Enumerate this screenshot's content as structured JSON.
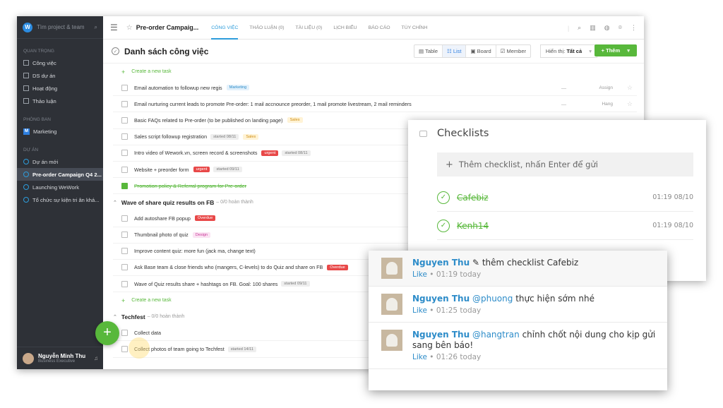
{
  "sidebar": {
    "search_placeholder": "Tìm project & team",
    "sections": [
      {
        "title": "QUAN TRỌNG",
        "items": [
          "Công việc",
          "DS dự án",
          "Hoạt động",
          "Thảo luận"
        ]
      },
      {
        "title": "PHÒNG BAN",
        "items": [
          "Marketing"
        ]
      },
      {
        "title": "DỰ ÁN",
        "items": [
          "Dự án mới",
          "Pre-order Campaign Q4 2...",
          "Launching WeWork",
          "Tổ chức sự kiện tri ân khá..."
        ]
      }
    ],
    "user": {
      "name": "Nguyễn Minh Thu",
      "role": "Business Executive"
    }
  },
  "topbar": {
    "title": "Pre-order Campaig...",
    "tabs": [
      "CÔNG VIỆC",
      "THẢO LUẬN (0)",
      "TÀI LIỆU (0)",
      "LỊCH BIỂU",
      "BÁO CÁO",
      "TÙY CHỈNH"
    ]
  },
  "header": {
    "title": "Danh sách công việc",
    "views": [
      "Table",
      "List",
      "Board",
      "Member"
    ],
    "filter_label": "Hiển thị:",
    "filter_value": "Tất cả",
    "add_label": "+ Thêm"
  },
  "create_task": "Create a new task",
  "group1": [
    {
      "title": "Email automation to followup new regis",
      "tag": "Marketing",
      "tag_type": "mk",
      "dash": "—",
      "assign": "Assign"
    },
    {
      "title": "Email nurturing current leads to promote Pre-order: 1 mail accnounce preorder, 1 mail promote livestream, 2 mail reminders",
      "dash": "—",
      "assign": "Hang"
    },
    {
      "title": "Basic FAQs related to Pre-order (to be published on landing page)",
      "tag": "Sales",
      "tag_type": "sales"
    },
    {
      "title": "Sales script followup registration",
      "date": "started 08/11",
      "tag": "Sales",
      "tag_type": "sales"
    },
    {
      "title": "Intro video of Wework.vn, screen record & screenshots",
      "tag": "urgent",
      "tag_type": "urg",
      "date": "started 08/11"
    },
    {
      "title": "Website + preorder form",
      "tag": "urgent",
      "tag_type": "urg",
      "date": "started 09/11"
    },
    {
      "title": "Promotion policy & Referral program for Pre-order",
      "done": true
    }
  ],
  "section2": {
    "title": "Wave of share quiz results on FB",
    "sub": "– 0/0 hoàn thành"
  },
  "group2": [
    {
      "title": "Add autoshare FB popup",
      "tag": "Overdue",
      "tag_type": "ov"
    },
    {
      "title": "Thumbnail photo of quiz",
      "tag": "Design",
      "tag_type": "des"
    },
    {
      "title": "Improve content quiz: more fun (jack ma, change text)"
    },
    {
      "title": "Ask Base team & close friends who (mangers, C-levels) to do Quiz and share on FB",
      "tag": "Overdue",
      "tag_type": "ov"
    },
    {
      "title": "Wave of Quiz results share + hashtags on FB. Goal: 100 shares",
      "date": "started 09/11"
    }
  ],
  "section3": {
    "title": "Techfest",
    "sub": "– 0/0 hoàn thành"
  },
  "group3": [
    {
      "title": "Collect data"
    },
    {
      "title": "Collect photos of team going to Techfest",
      "date": "started 14/11"
    }
  ],
  "checklist": {
    "title": "Checklists",
    "input_placeholder": "Thêm checklist, nhấn Enter để gửi",
    "items": [
      {
        "name": "Cafebiz",
        "time": "01:19 08/10"
      },
      {
        "name": "Kenh14",
        "time": "01:19 08/10"
      }
    ]
  },
  "comments": [
    {
      "name": "Nguyen Thu",
      "mention": "",
      "text": "thêm checklist Cafebiz",
      "like": "Like",
      "time": "01:19 today",
      "edit_icon": "pencil-icon"
    },
    {
      "name": "Nguyen Thu",
      "mention": "@phuong",
      "text": "thực hiện sớm nhé",
      "like": "Like",
      "time": "01:25 today"
    },
    {
      "name": "Nguyen Thu",
      "mention": "@hangtran",
      "text": "chỉnh chốt nội dung cho kịp gửi sang bên báo!",
      "like": "Like",
      "time": "01:26 today"
    }
  ],
  "colors": {
    "accent_green": "#58b83b",
    "accent_blue": "#2d9cdb",
    "sidebar_bg": "#2e3137"
  }
}
